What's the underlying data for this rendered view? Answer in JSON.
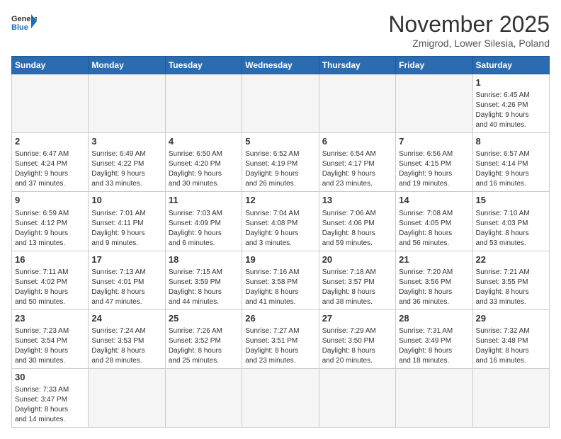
{
  "logo": {
    "text_general": "General",
    "text_blue": "Blue"
  },
  "header": {
    "month_year": "November 2025",
    "location": "Zmigrod, Lower Silesia, Poland"
  },
  "days_of_week": [
    "Sunday",
    "Monday",
    "Tuesday",
    "Wednesday",
    "Thursday",
    "Friday",
    "Saturday"
  ],
  "weeks": [
    [
      {
        "day": "",
        "info": ""
      },
      {
        "day": "",
        "info": ""
      },
      {
        "day": "",
        "info": ""
      },
      {
        "day": "",
        "info": ""
      },
      {
        "day": "",
        "info": ""
      },
      {
        "day": "",
        "info": ""
      },
      {
        "day": "1",
        "info": "Sunrise: 6:45 AM\nSunset: 4:26 PM\nDaylight: 9 hours\nand 40 minutes."
      }
    ],
    [
      {
        "day": "2",
        "info": "Sunrise: 6:47 AM\nSunset: 4:24 PM\nDaylight: 9 hours\nand 37 minutes."
      },
      {
        "day": "3",
        "info": "Sunrise: 6:49 AM\nSunset: 4:22 PM\nDaylight: 9 hours\nand 33 minutes."
      },
      {
        "day": "4",
        "info": "Sunrise: 6:50 AM\nSunset: 4:20 PM\nDaylight: 9 hours\nand 30 minutes."
      },
      {
        "day": "5",
        "info": "Sunrise: 6:52 AM\nSunset: 4:19 PM\nDaylight: 9 hours\nand 26 minutes."
      },
      {
        "day": "6",
        "info": "Sunrise: 6:54 AM\nSunset: 4:17 PM\nDaylight: 9 hours\nand 23 minutes."
      },
      {
        "day": "7",
        "info": "Sunrise: 6:56 AM\nSunset: 4:15 PM\nDaylight: 9 hours\nand 19 minutes."
      },
      {
        "day": "8",
        "info": "Sunrise: 6:57 AM\nSunset: 4:14 PM\nDaylight: 9 hours\nand 16 minutes."
      }
    ],
    [
      {
        "day": "9",
        "info": "Sunrise: 6:59 AM\nSunset: 4:12 PM\nDaylight: 9 hours\nand 13 minutes."
      },
      {
        "day": "10",
        "info": "Sunrise: 7:01 AM\nSunset: 4:11 PM\nDaylight: 9 hours\nand 9 minutes."
      },
      {
        "day": "11",
        "info": "Sunrise: 7:03 AM\nSunset: 4:09 PM\nDaylight: 9 hours\nand 6 minutes."
      },
      {
        "day": "12",
        "info": "Sunrise: 7:04 AM\nSunset: 4:08 PM\nDaylight: 9 hours\nand 3 minutes."
      },
      {
        "day": "13",
        "info": "Sunrise: 7:06 AM\nSunset: 4:06 PM\nDaylight: 8 hours\nand 59 minutes."
      },
      {
        "day": "14",
        "info": "Sunrise: 7:08 AM\nSunset: 4:05 PM\nDaylight: 8 hours\nand 56 minutes."
      },
      {
        "day": "15",
        "info": "Sunrise: 7:10 AM\nSunset: 4:03 PM\nDaylight: 8 hours\nand 53 minutes."
      }
    ],
    [
      {
        "day": "16",
        "info": "Sunrise: 7:11 AM\nSunset: 4:02 PM\nDaylight: 8 hours\nand 50 minutes."
      },
      {
        "day": "17",
        "info": "Sunrise: 7:13 AM\nSunset: 4:01 PM\nDaylight: 8 hours\nand 47 minutes."
      },
      {
        "day": "18",
        "info": "Sunrise: 7:15 AM\nSunset: 3:59 PM\nDaylight: 8 hours\nand 44 minutes."
      },
      {
        "day": "19",
        "info": "Sunrise: 7:16 AM\nSunset: 3:58 PM\nDaylight: 8 hours\nand 41 minutes."
      },
      {
        "day": "20",
        "info": "Sunrise: 7:18 AM\nSunset: 3:57 PM\nDaylight: 8 hours\nand 38 minutes."
      },
      {
        "day": "21",
        "info": "Sunrise: 7:20 AM\nSunset: 3:56 PM\nDaylight: 8 hours\nand 36 minutes."
      },
      {
        "day": "22",
        "info": "Sunrise: 7:21 AM\nSunset: 3:55 PM\nDaylight: 8 hours\nand 33 minutes."
      }
    ],
    [
      {
        "day": "23",
        "info": "Sunrise: 7:23 AM\nSunset: 3:54 PM\nDaylight: 8 hours\nand 30 minutes."
      },
      {
        "day": "24",
        "info": "Sunrise: 7:24 AM\nSunset: 3:53 PM\nDaylight: 8 hours\nand 28 minutes."
      },
      {
        "day": "25",
        "info": "Sunrise: 7:26 AM\nSunset: 3:52 PM\nDaylight: 8 hours\nand 25 minutes."
      },
      {
        "day": "26",
        "info": "Sunrise: 7:27 AM\nSunset: 3:51 PM\nDaylight: 8 hours\nand 23 minutes."
      },
      {
        "day": "27",
        "info": "Sunrise: 7:29 AM\nSunset: 3:50 PM\nDaylight: 8 hours\nand 20 minutes."
      },
      {
        "day": "28",
        "info": "Sunrise: 7:31 AM\nSunset: 3:49 PM\nDaylight: 8 hours\nand 18 minutes."
      },
      {
        "day": "29",
        "info": "Sunrise: 7:32 AM\nSunset: 3:48 PM\nDaylight: 8 hours\nand 16 minutes."
      }
    ],
    [
      {
        "day": "30",
        "info": "Sunrise: 7:33 AM\nSunset: 3:47 PM\nDaylight: 8 hours\nand 14 minutes."
      },
      {
        "day": "",
        "info": ""
      },
      {
        "day": "",
        "info": ""
      },
      {
        "day": "",
        "info": ""
      },
      {
        "day": "",
        "info": ""
      },
      {
        "day": "",
        "info": ""
      },
      {
        "day": "",
        "info": ""
      }
    ]
  ]
}
